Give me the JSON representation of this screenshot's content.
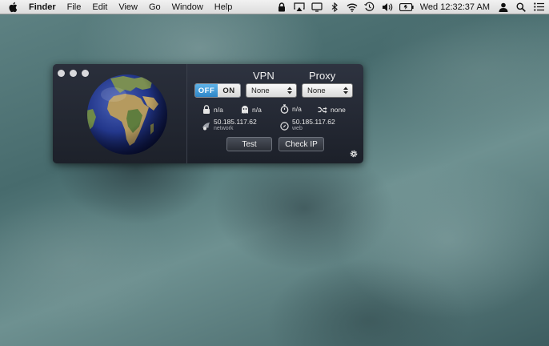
{
  "menubar": {
    "items": [
      {
        "label": "Finder",
        "bold": true
      },
      {
        "label": "File"
      },
      {
        "label": "Edit"
      },
      {
        "label": "View"
      },
      {
        "label": "Go"
      },
      {
        "label": "Window"
      },
      {
        "label": "Help"
      }
    ],
    "status_icons": [
      "lock-icon",
      "airplay-icon",
      "display-icon",
      "bluetooth-icon",
      "wifi-icon",
      "time-machine-icon",
      "volume-icon",
      "battery-icon"
    ],
    "clock": "Wed 12:32:37 AM",
    "right_icons": [
      "user-icon",
      "spotlight-icon",
      "notification-list-icon"
    ]
  },
  "window": {
    "vpn_header": "VPN",
    "proxy_header": "Proxy",
    "toggle": {
      "off_label": "OFF",
      "on_label": "ON",
      "state": "off"
    },
    "vpn_select": "None",
    "proxy_select": "None",
    "vpn_lock_value": "n/a",
    "vpn_ghost_value": "n/a",
    "proxy_timer_value": "n/a",
    "proxy_shuffle_value": "none",
    "network_ip": "50.185.117.62",
    "network_label": "network",
    "web_ip": "50.185.117.62",
    "web_label": "web",
    "test_button": "Test",
    "checkip_button": "Check IP"
  },
  "colors": {
    "toggle_active": "#2e86c8",
    "window_bg": "#1c2029"
  }
}
